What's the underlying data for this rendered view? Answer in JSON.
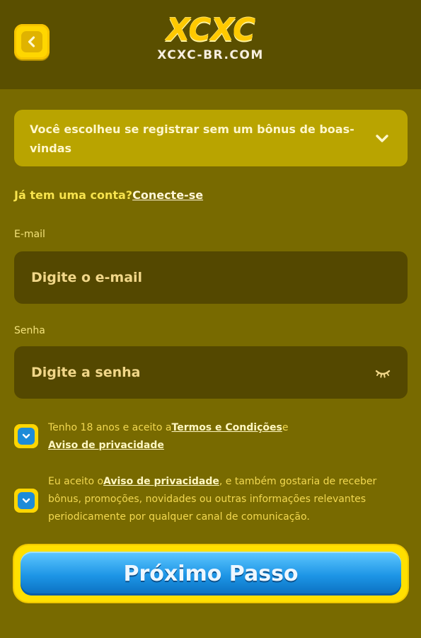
{
  "header": {
    "back_icon": "chevron-left-icon",
    "logo_text": "XCXC",
    "domain": "XCXC-BR.COM"
  },
  "bonus": {
    "text": "Você escolheu se registrar sem um bônus de boas-vindas",
    "chevron_icon": "chevron-down-icon"
  },
  "login": {
    "prompt": "Já tem uma conta?",
    "link": "Conecte-se"
  },
  "email": {
    "label": "E-mail",
    "placeholder": "Digite o e-mail",
    "value": ""
  },
  "password": {
    "label": "Senha",
    "placeholder": "Digite a senha",
    "value": "",
    "toggle_icon": "eye-closed-icon"
  },
  "consent_terms": {
    "checked": true,
    "text_before": "Tenho 18 anos e aceito a",
    "terms_link": "Termos e Condições",
    "text_mid": "e",
    "privacy_link": "Aviso de privacidade"
  },
  "consent_marketing": {
    "checked": true,
    "text_before": "Eu aceito o",
    "privacy_link": "Aviso de privacidade",
    "text_after": ", e também gostaria de receber bônus, promoções, novidades ou outras informações relevantes periodicamente por qualquer canal de comunicação."
  },
  "next_button": {
    "label": "Próximo Passo"
  },
  "colors": {
    "background": "#786a00",
    "header": "#5a4f00",
    "accent_yellow": "#ffd600",
    "button_blue": "#1d95e6"
  }
}
